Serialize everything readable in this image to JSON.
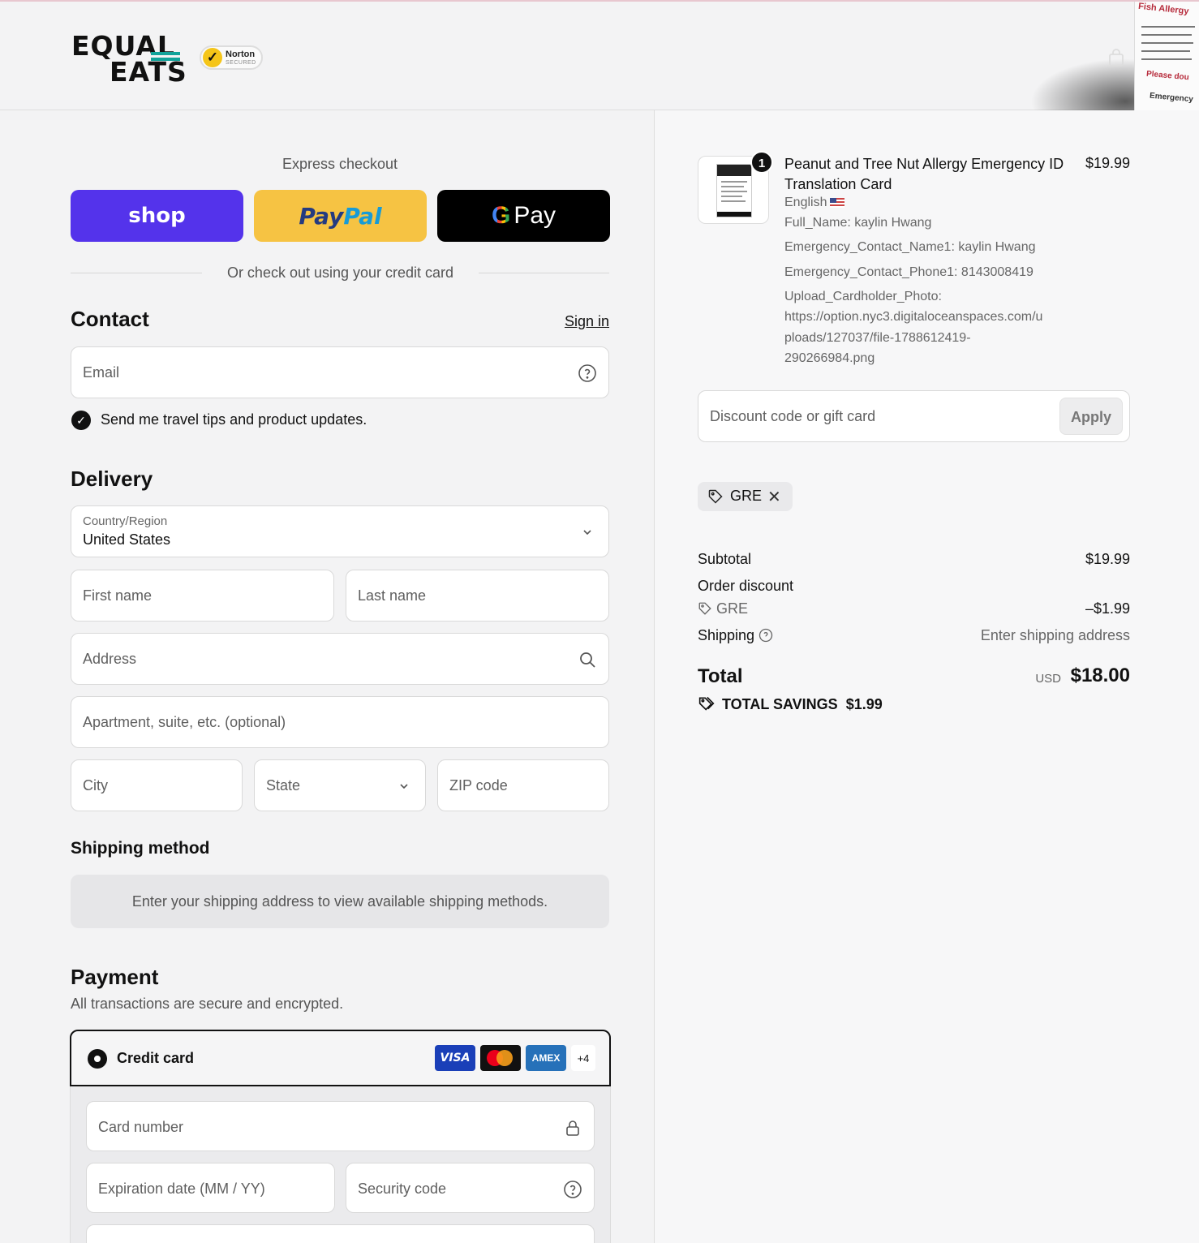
{
  "header": {
    "logo_line1": "EQUAL",
    "logo_line2": "EATS",
    "norton_name": "Norton",
    "norton_sub": "SECURED",
    "poster_title": "Fish Allergy",
    "poster_please": "Please dou",
    "poster_emergency": "Emergency"
  },
  "express": {
    "title": "Express checkout",
    "shop_label": "shop",
    "paypal_label_pay": "Pay",
    "paypal_label_pal": "Pal",
    "gpay_g": "G",
    "gpay_label": "Pay",
    "divider_text": "Or check out using your credit card"
  },
  "contact": {
    "title": "Contact",
    "sign_in": "Sign in",
    "email_placeholder": "Email",
    "newsletter_label": "Send me travel tips and product updates.",
    "newsletter_checked": true
  },
  "delivery": {
    "title": "Delivery",
    "country_label": "Country/Region",
    "country_value": "United States",
    "first_name": "First name",
    "last_name": "Last name",
    "address": "Address",
    "apartment": "Apartment, suite, etc. (optional)",
    "city": "City",
    "state": "State",
    "zip": "ZIP code"
  },
  "shipping_method": {
    "title": "Shipping method",
    "message": "Enter your shipping address to view available shipping methods."
  },
  "payment": {
    "title": "Payment",
    "subtitle": "All transactions are secure and encrypted.",
    "method_label": "Credit card",
    "card_brands": [
      "VISA",
      "Mastercard",
      "AMEX"
    ],
    "more_brands": "+4",
    "card_number": "Card number",
    "expiration": "Expiration date (MM / YY)",
    "security_code": "Security code"
  },
  "order": {
    "quantity": "1",
    "product_title": "Peanut and Tree Nut Allergy Emergency ID Translation Card",
    "product_price": "$19.99",
    "language": "English",
    "full_name": "Full_Name: kaylin Hwang",
    "emergency_name": "Emergency_Contact_Name1: kaylin Hwang",
    "emergency_phone": "Emergency_Contact_Phone1: 8143008419",
    "upload_label": "Upload_Cardholder_Photo:",
    "upload_url_1": "https://option.nyc3.digitaloceanspaces.com/u",
    "upload_url_2": "ploads/127037/file-1788612419-",
    "upload_url_3": "290266984.png",
    "discount_placeholder": "Discount code or gift card",
    "apply_label": "Apply",
    "applied_code": "GRE",
    "subtotal_label": "Subtotal",
    "subtotal_value": "$19.99",
    "order_discount_label": "Order discount",
    "discount_code": "GRE",
    "discount_value": "–$1.99",
    "shipping_label": "Shipping",
    "shipping_value": "Enter shipping address",
    "total_label": "Total",
    "currency": "USD",
    "total_value": "$18.00",
    "savings_label": "TOTAL SAVINGS",
    "savings_value": "$1.99"
  },
  "colors": {
    "shop_pay": "#5433eb",
    "paypal": "#f6c343",
    "gpay": "#000000",
    "accent_teal": "#11a39a"
  }
}
